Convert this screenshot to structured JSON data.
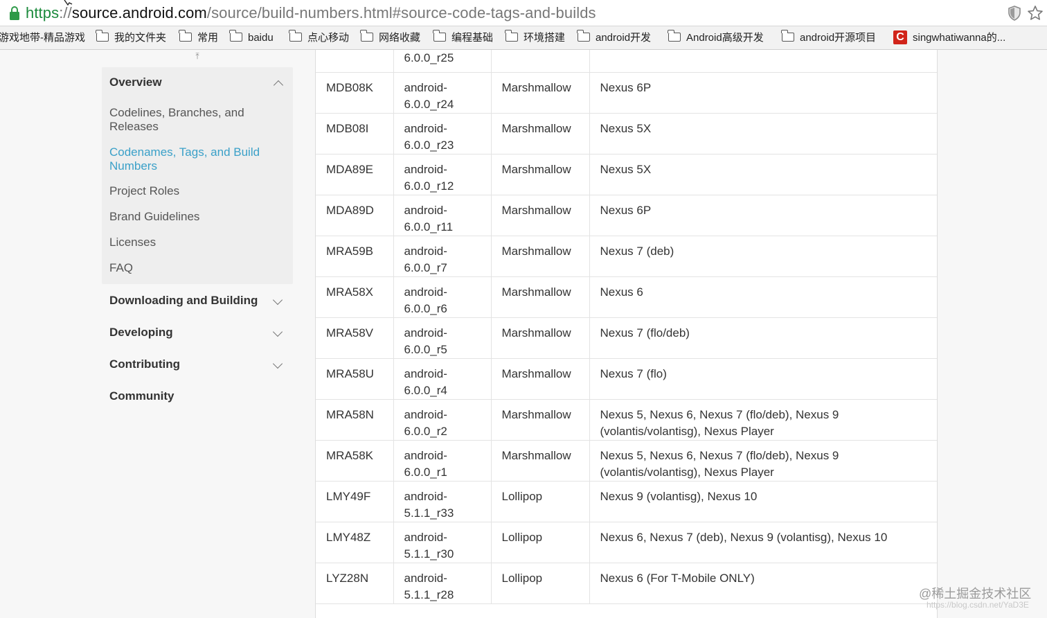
{
  "browser": {
    "url_scheme": "https",
    "url_sep": "://",
    "url_host": "source.android.com",
    "url_path": "/source/build-numbers.html#source-code-tags-and-builds",
    "bookmarks": [
      {
        "label": "游戏地带-精品游戏",
        "icon": "none"
      },
      {
        "label": "我的文件夹",
        "icon": "folder-icon"
      },
      {
        "label": "常用",
        "icon": "folder-icon"
      },
      {
        "label": "baidu",
        "icon": "folder-icon"
      },
      {
        "label": "点心移动",
        "icon": "folder-icon"
      },
      {
        "label": "网络收藏",
        "icon": "folder-icon"
      },
      {
        "label": "编程基础",
        "icon": "folder-icon"
      },
      {
        "label": "环境搭建",
        "icon": "folder-icon"
      },
      {
        "label": "android开发",
        "icon": "folder-icon"
      },
      {
        "label": "Android高级开发",
        "icon": "folder-icon"
      },
      {
        "label": "android开源项目",
        "icon": "folder-icon"
      },
      {
        "label": "singwhatiwanna的...",
        "icon": "csdn-icon",
        "icon_letter": "C"
      }
    ]
  },
  "sidebar": {
    "overview": {
      "title": "Overview",
      "items": [
        {
          "label": "Codelines, Branches, and Releases"
        },
        {
          "label": "Codenames, Tags, and Build Numbers",
          "active": true
        },
        {
          "label": "Project Roles"
        },
        {
          "label": "Brand Guidelines"
        },
        {
          "label": "Licenses"
        },
        {
          "label": "FAQ"
        }
      ]
    },
    "sections": [
      {
        "label": "Downloading and Building",
        "expandable": true
      },
      {
        "label": "Developing",
        "expandable": true
      },
      {
        "label": "Contributing",
        "expandable": true
      },
      {
        "label": "Community",
        "expandable": false
      }
    ]
  },
  "table": {
    "partial_row": {
      "tag": "6.0.0_r25"
    },
    "rows": [
      {
        "build": "MDB08K",
        "tag": "android-6.0.0_r24",
        "version": "Marshmallow",
        "devices": "Nexus 6P"
      },
      {
        "build": "MDB08I",
        "tag": "android-6.0.0_r23",
        "version": "Marshmallow",
        "devices": "Nexus 5X"
      },
      {
        "build": "MDA89E",
        "tag": "android-6.0.0_r12",
        "version": "Marshmallow",
        "devices": "Nexus 5X"
      },
      {
        "build": "MDA89D",
        "tag": "android-6.0.0_r11",
        "version": "Marshmallow",
        "devices": "Nexus 6P"
      },
      {
        "build": "MRA59B",
        "tag": "android-6.0.0_r7",
        "version": "Marshmallow",
        "devices": "Nexus 7 (deb)"
      },
      {
        "build": "MRA58X",
        "tag": "android-6.0.0_r6",
        "version": "Marshmallow",
        "devices": "Nexus 6"
      },
      {
        "build": "MRA58V",
        "tag": "android-6.0.0_r5",
        "version": "Marshmallow",
        "devices": "Nexus 7 (flo/deb)"
      },
      {
        "build": "MRA58U",
        "tag": "android-6.0.0_r4",
        "version": "Marshmallow",
        "devices": "Nexus 7 (flo)"
      },
      {
        "build": "MRA58N",
        "tag": "android-6.0.0_r2",
        "version": "Marshmallow",
        "devices": "Nexus 5, Nexus 6, Nexus 7 (flo/deb), Nexus 9 (volantis/volantisg), Nexus Player"
      },
      {
        "build": "MRA58K",
        "tag": "android-6.0.0_r1",
        "version": "Marshmallow",
        "devices": "Nexus 5, Nexus 6, Nexus 7 (flo/deb), Nexus 9 (volantis/volantisg), Nexus Player"
      },
      {
        "build": "LMY49F",
        "tag": "android-5.1.1_r33",
        "version": "Lollipop",
        "devices": "Nexus 9 (volantisg), Nexus 10"
      },
      {
        "build": "LMY48Z",
        "tag": "android-5.1.1_r30",
        "version": "Lollipop",
        "devices": "Nexus 6, Nexus 7 (deb), Nexus 9 (volantisg), Nexus 10"
      },
      {
        "build": "LYZ28N",
        "tag": "android-5.1.1_r28",
        "version": "Lollipop",
        "devices": "Nexus 6 (For T-Mobile ONLY)"
      }
    ]
  },
  "watermark": {
    "text": "@稀土掘金技术社区",
    "subtext": "https://blog.csdn.net/YaD3E"
  }
}
